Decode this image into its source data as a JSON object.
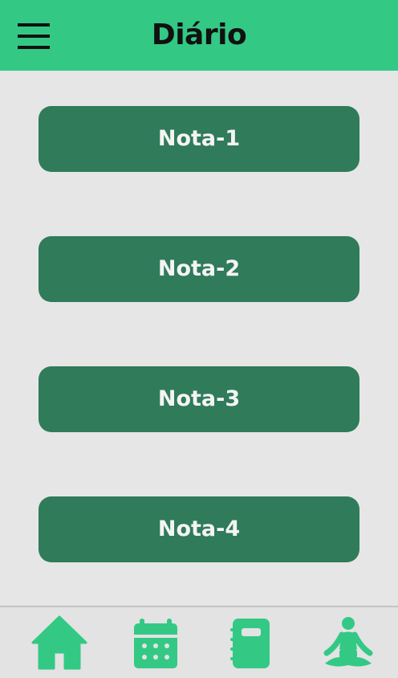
{
  "header": {
    "title": "Diário",
    "menu_icon": "hamburger-menu-icon",
    "background_color": "#33c985"
  },
  "notes": [
    {
      "label": "Nota-1"
    },
    {
      "label": "Nota-2"
    },
    {
      "label": "Nota-3"
    },
    {
      "label": "Nota-4"
    }
  ],
  "note_button_color": "#2f7b5a",
  "bottom_nav": {
    "items": [
      {
        "icon": "home-icon"
      },
      {
        "icon": "calendar-icon"
      },
      {
        "icon": "notebook-icon"
      },
      {
        "icon": "meditation-icon"
      }
    ],
    "icon_color": "#33c985"
  }
}
